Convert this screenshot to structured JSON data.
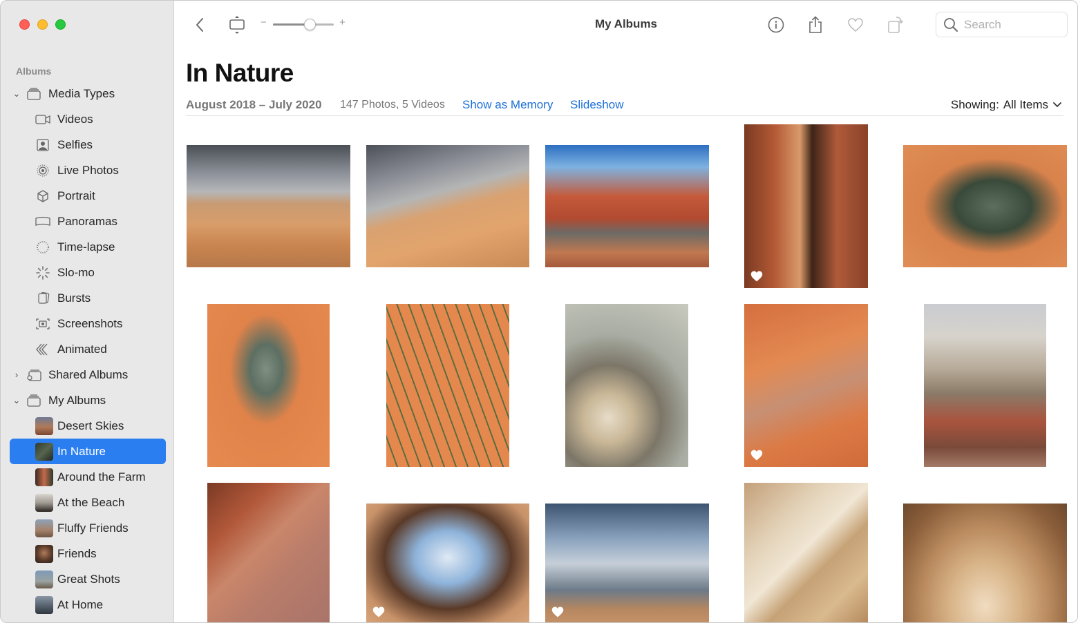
{
  "window": {
    "title": "My Albums"
  },
  "toolbar": {
    "zoom_minus": "−",
    "zoom_plus": "+",
    "zoom_level": 0.6
  },
  "search": {
    "placeholder": "Search",
    "value": ""
  },
  "sidebar": {
    "section_title": "Albums",
    "media_types_label": "Media Types",
    "media_types": [
      "Videos",
      "Selfies",
      "Live Photos",
      "Portrait",
      "Panoramas",
      "Time-lapse",
      "Slo-mo",
      "Bursts",
      "Screenshots",
      "Animated"
    ],
    "shared_albums_label": "Shared Albums",
    "my_albums_label": "My Albums",
    "my_albums": [
      "Desert Skies",
      "In Nature",
      "Around the Farm",
      "At the Beach",
      "Fluffy Friends",
      "Friends",
      "Great Shots",
      "At Home"
    ],
    "selected": "In Nature"
  },
  "album": {
    "title": "In Nature",
    "date_range": "August 2018 – July 2020",
    "counts": "147 Photos, 5 Videos",
    "show_as_memory": "Show as Memory",
    "slideshow": "Slideshow",
    "showing_prefix": "Showing:",
    "showing_value": "All Items"
  },
  "colors": {
    "accent": "#2a7ef0",
    "link": "#1a6ed8",
    "sidebar_bg": "#e8e8e8"
  },
  "photos": [
    {
      "subject": "desert-slope-cloudy",
      "favorite": false
    },
    {
      "subject": "hiker-on-sandstone",
      "favorite": false
    },
    {
      "subject": "desert-road-red-rocks",
      "favorite": false
    },
    {
      "subject": "slot-canyon-hiker",
      "favorite": true
    },
    {
      "subject": "desert-milkweed-plant",
      "favorite": false
    },
    {
      "subject": "plant-in-red-sand",
      "favorite": false
    },
    {
      "subject": "grass-blades-sand",
      "favorite": false
    },
    {
      "subject": "milkweed-pods-closeup",
      "favorite": false
    },
    {
      "subject": "hand-pouring-sand",
      "favorite": true
    },
    {
      "subject": "white-rock-formation",
      "favorite": false
    },
    {
      "subject": "striped-canyon-wall",
      "favorite": false
    },
    {
      "subject": "sandstone-arch-sky",
      "favorite": true
    },
    {
      "subject": "silhouette-on-dune",
      "favorite": true
    },
    {
      "subject": "swirled-sandstone",
      "favorite": false
    },
    {
      "subject": "sandstone-alcove-hiker",
      "favorite": false
    }
  ]
}
